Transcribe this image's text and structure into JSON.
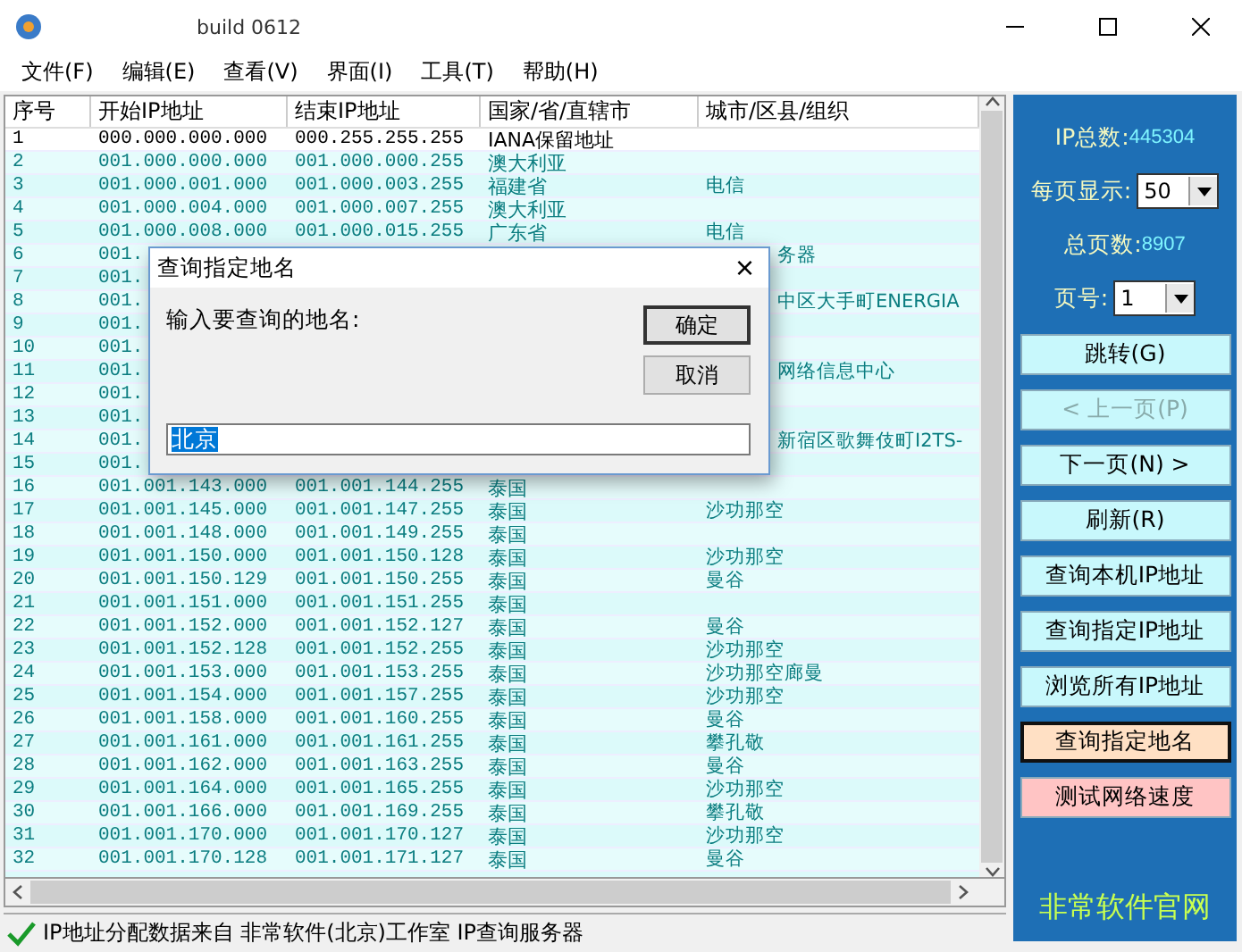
{
  "window": {
    "title": "build 0612"
  },
  "menu": [
    "文件(F)",
    "编辑(E)",
    "查看(V)",
    "界面(I)",
    "工具(T)",
    "帮助(H)"
  ],
  "table": {
    "columns": [
      "序号",
      "开始IP地址",
      "结束IP地址",
      "国家/省/直辖市",
      "城市/区县/组织"
    ],
    "rows": [
      {
        "kind": "reserved",
        "cells": [
          "1",
          "000.000.000.000",
          "000.255.255.255",
          "IANA保留地址",
          ""
        ]
      },
      {
        "kind": "normal",
        "cells": [
          "2",
          "001.000.000.000",
          "001.000.000.255",
          "澳大利亚",
          ""
        ]
      },
      {
        "kind": "normal",
        "cells": [
          "3",
          "001.000.001.000",
          "001.000.003.255",
          "福建省",
          "电信"
        ]
      },
      {
        "kind": "normal",
        "cells": [
          "4",
          "001.000.004.000",
          "001.000.007.255",
          "澳大利亚",
          ""
        ]
      },
      {
        "kind": "normal",
        "cells": [
          "5",
          "001.000.008.000",
          "001.000.015.255",
          "广东省",
          "电信"
        ]
      },
      {
        "kind": "normal",
        "cells": [
          "6",
          "001.",
          "",
          "",
          "务器"
        ]
      },
      {
        "kind": "normal",
        "cells": [
          "7",
          "001.",
          "",
          "",
          ""
        ]
      },
      {
        "kind": "normal",
        "cells": [
          "8",
          "001.",
          "",
          "",
          "中区大手町ENERGIA"
        ]
      },
      {
        "kind": "normal",
        "cells": [
          "9",
          "001.",
          "",
          "",
          ""
        ]
      },
      {
        "kind": "normal",
        "cells": [
          "10",
          "001.",
          "",
          "",
          ""
        ]
      },
      {
        "kind": "normal",
        "cells": [
          "11",
          "001.",
          "",
          "",
          "网络信息中心"
        ]
      },
      {
        "kind": "normal",
        "cells": [
          "12",
          "001.",
          "",
          "",
          ""
        ]
      },
      {
        "kind": "normal",
        "cells": [
          "13",
          "001.",
          "",
          "",
          ""
        ]
      },
      {
        "kind": "normal",
        "cells": [
          "14",
          "001.",
          "",
          "",
          "新宿区歌舞伎町I2TS-"
        ]
      },
      {
        "kind": "normal",
        "cells": [
          "15",
          "001.",
          "",
          "",
          ""
        ]
      },
      {
        "kind": "normal",
        "cells": [
          "16",
          "001.001.143.000",
          "001.001.144.255",
          "泰国",
          ""
        ]
      },
      {
        "kind": "normal",
        "cells": [
          "17",
          "001.001.145.000",
          "001.001.147.255",
          "泰国",
          "沙功那空"
        ]
      },
      {
        "kind": "normal",
        "cells": [
          "18",
          "001.001.148.000",
          "001.001.149.255",
          "泰国",
          ""
        ]
      },
      {
        "kind": "normal",
        "cells": [
          "19",
          "001.001.150.000",
          "001.001.150.128",
          "泰国",
          "沙功那空"
        ]
      },
      {
        "kind": "normal",
        "cells": [
          "20",
          "001.001.150.129",
          "001.001.150.255",
          "泰国",
          "曼谷"
        ]
      },
      {
        "kind": "normal",
        "cells": [
          "21",
          "001.001.151.000",
          "001.001.151.255",
          "泰国",
          ""
        ]
      },
      {
        "kind": "normal",
        "cells": [
          "22",
          "001.001.152.000",
          "001.001.152.127",
          "泰国",
          "曼谷"
        ]
      },
      {
        "kind": "normal",
        "cells": [
          "23",
          "001.001.152.128",
          "001.001.152.255",
          "泰国",
          "沙功那空"
        ]
      },
      {
        "kind": "normal",
        "cells": [
          "24",
          "001.001.153.000",
          "001.001.153.255",
          "泰国",
          "沙功那空廊曼"
        ]
      },
      {
        "kind": "normal",
        "cells": [
          "25",
          "001.001.154.000",
          "001.001.157.255",
          "泰国",
          "沙功那空"
        ]
      },
      {
        "kind": "normal",
        "cells": [
          "26",
          "001.001.158.000",
          "001.001.160.255",
          "泰国",
          "曼谷"
        ]
      },
      {
        "kind": "normal",
        "cells": [
          "27",
          "001.001.161.000",
          "001.001.161.255",
          "泰国",
          "攀孔敬"
        ]
      },
      {
        "kind": "normal",
        "cells": [
          "28",
          "001.001.162.000",
          "001.001.163.255",
          "泰国",
          "曼谷"
        ]
      },
      {
        "kind": "normal",
        "cells": [
          "29",
          "001.001.164.000",
          "001.001.165.255",
          "泰国",
          "沙功那空"
        ]
      },
      {
        "kind": "normal",
        "cells": [
          "30",
          "001.001.166.000",
          "001.001.169.255",
          "泰国",
          "攀孔敬"
        ]
      },
      {
        "kind": "normal",
        "cells": [
          "31",
          "001.001.170.000",
          "001.001.170.127",
          "泰国",
          "沙功那空"
        ]
      },
      {
        "kind": "normal",
        "cells": [
          "32",
          "001.001.170.128",
          "001.001.171.127",
          "泰国",
          "曼谷"
        ]
      }
    ]
  },
  "dialog": {
    "title": "查询指定地名",
    "close": "×",
    "prompt": "输入要查询的地名:",
    "value": "北京",
    "buttons": [
      {
        "label": "确定",
        "default": true
      },
      {
        "label": "取消",
        "default": false
      }
    ]
  },
  "panel": {
    "total_label": "IP总数:",
    "total": "445304",
    "per_page_label": "每页显示:",
    "per_page": "50",
    "pages_label": "总页数:",
    "pages": "8907",
    "page_label": "页号:",
    "page": "1",
    "buttons": [
      {
        "label": "跳转(G)",
        "kind": "normal",
        "disabled": false,
        "focused": false
      },
      {
        "label": "< 上一页(P)",
        "kind": "normal",
        "disabled": true,
        "focused": false
      },
      {
        "label": "下一页(N) >",
        "kind": "normal",
        "disabled": false,
        "focused": false
      },
      {
        "label": "刷新(R)",
        "kind": "normal",
        "disabled": false,
        "focused": false
      },
      {
        "label": "查询本机IP地址",
        "kind": "normal",
        "disabled": false,
        "focused": false
      },
      {
        "label": "查询指定IP地址",
        "kind": "normal",
        "disabled": false,
        "focused": false
      },
      {
        "label": "浏览所有IP地址",
        "kind": "normal",
        "disabled": false,
        "focused": false
      },
      {
        "label": "查询指定地名",
        "kind": "accent",
        "disabled": false,
        "focused": true
      },
      {
        "label": "测试网络速度",
        "kind": "warning",
        "disabled": false,
        "focused": false
      }
    ],
    "footer": "非常软件官网"
  },
  "status_bar": {
    "text": "IP地址分配数据来自 非常软件(北京)工作室 IP查询服务器"
  }
}
